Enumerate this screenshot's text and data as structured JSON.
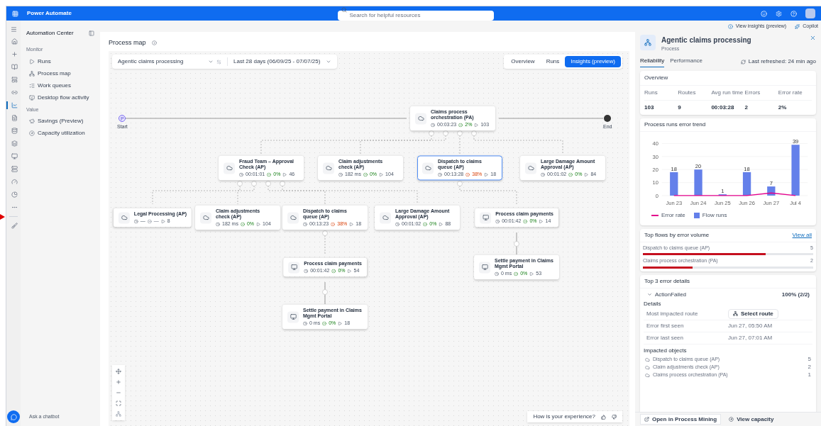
{
  "app_bar": {
    "title": "Power Automate",
    "search": {
      "placeholder": "Search for helpful resources"
    }
  },
  "rail": [
    {
      "selected": false
    },
    {
      "selected": false
    },
    {
      "selected": false
    },
    {
      "selected": false
    },
    {
      "selected": false
    },
    {
      "selected": true
    },
    {
      "selected": false
    },
    {
      "selected": false
    },
    {
      "selected": false
    },
    {
      "selected": false
    },
    {
      "selected": false
    },
    {
      "selected": false
    },
    {
      "selected": false
    },
    {
      "selected": false
    },
    {
      "selected": false
    }
  ],
  "nav": {
    "title": "Automation Center",
    "sections": [
      {
        "heading": "Monitor",
        "items": [
          "Runs",
          "Process map",
          "Work queues",
          "Desktop flow activity"
        ]
      },
      {
        "heading": "Value",
        "items": [
          "Savings (Preview)",
          "Capacity utilization"
        ]
      }
    ],
    "chatbot": "Ask a chatbot"
  },
  "header_links": [
    "View insights (preview)",
    "Copilot"
  ],
  "page_title": "Process map",
  "map": {
    "process_select": "Agentic claims processing",
    "date_range": "Last 28 days (06/09/25 - 07/07/25)",
    "view_tabs": [
      {
        "label": "Overview",
        "selected": false
      },
      {
        "label": "Runs",
        "selected": false
      },
      {
        "label": "Insights (preview)",
        "selected": true
      }
    ],
    "start": {
      "marker": "P",
      "label": "Start"
    },
    "end": {
      "label": "End"
    },
    "nodes": [
      {
        "kind": "cloud",
        "title": "Claims process orchestration (PA)",
        "time": "00:03:23",
        "rate": "2%",
        "warning": false,
        "empty": false,
        "runs": "103",
        "selected": false
      },
      {
        "kind": "cloud",
        "title": "Fraud Team – Approval Check (AP)",
        "time": "00:01:01",
        "rate": "0%",
        "warning": false,
        "empty": false,
        "runs": "46",
        "selected": false
      },
      {
        "kind": "cloud",
        "title": "Claim adjustments check (AP)",
        "time": "182 ms",
        "rate": "0%",
        "warning": false,
        "empty": false,
        "runs": "104",
        "selected": false
      },
      {
        "kind": "cloud",
        "title": "Dispatch to claims queue (AP)",
        "time": "00:13:28",
        "rate": "38%",
        "warning": true,
        "empty": false,
        "runs": "18",
        "selected": true
      },
      {
        "kind": "cloud",
        "title": "Large Damage Amount Approval (AP)",
        "time": "00:01:02",
        "rate": "0%",
        "warning": false,
        "empty": false,
        "runs": "84",
        "selected": false
      },
      {
        "kind": "cloud",
        "title": "Legal Processing (AP)",
        "time": "—",
        "rate": "—",
        "warning": false,
        "empty": true,
        "runs": "8",
        "selected": false
      },
      {
        "kind": "cloud",
        "title": "Claim adjustments check (AP)",
        "time": "182 ms",
        "rate": "0%",
        "warning": false,
        "empty": false,
        "runs": "104",
        "selected": false
      },
      {
        "kind": "cloud",
        "title": "Dispatch to claims queue (AP)",
        "time": "00:13:23",
        "rate": "38%",
        "warning": true,
        "empty": false,
        "runs": "18",
        "selected": false
      },
      {
        "kind": "cloud",
        "title": "Large Damage Amount Approval (AP)",
        "time": "00:01:02",
        "rate": "0%",
        "warning": false,
        "empty": false,
        "runs": "88",
        "selected": false
      },
      {
        "kind": "desktop",
        "title": "Process claim payments",
        "time": "00:01:42",
        "rate": "0%",
        "warning": false,
        "empty": false,
        "runs": "14",
        "selected": false
      },
      {
        "kind": "desktop",
        "title": "Process claim payments",
        "time": "00:01:42",
        "rate": "0%",
        "warning": false,
        "empty": false,
        "runs": "54",
        "selected": false
      },
      {
        "kind": "desktop",
        "title": "Settle payment in Claims Mgmt Portal",
        "time": "0 ms",
        "rate": "0%",
        "warning": false,
        "empty": false,
        "runs": "53",
        "selected": false
      },
      {
        "kind": "desktop",
        "title": "Settle payment in Claims Mgmt Portal",
        "time": "0 ms",
        "rate": "0%",
        "warning": false,
        "empty": false,
        "runs": "18",
        "selected": false
      }
    ],
    "feedback": "How is your experience?"
  },
  "details": {
    "title": "Agentic claims processing",
    "subtitle": "Process",
    "tabs": [
      {
        "label": "Reliability",
        "selected": true
      },
      {
        "label": "Performance",
        "selected": false
      }
    ],
    "refreshed": "Last refreshed: 24 min ago",
    "overview": {
      "title": "Overview",
      "columns": [
        "Runs",
        "Routes",
        "Avg run time",
        "Errors",
        "Error rate"
      ],
      "values": [
        "103",
        "9",
        "00:03:28",
        "2",
        "2%"
      ]
    },
    "trend": {
      "title": "Process runs error trend",
      "chart_data": {
        "type": "bar",
        "categories": [
          "Jun 23",
          "Jun 24",
          "Jun 25",
          "Jun 26",
          "Jun 27",
          "Jul 4"
        ],
        "grid": true,
        "series": [
          {
            "name": "Error rate",
            "type": "line",
            "color": "#e3008c",
            "values": [
              0,
              0,
              0,
              0,
              2,
              0
            ]
          },
          {
            "name": "Flow runs",
            "type": "bar",
            "color": "#6480ea",
            "values": [
              18,
              20,
              1,
              18,
              7,
              39
            ]
          }
        ],
        "legend": "bottom",
        "ylim": [
          0,
          40
        ],
        "yticks": [
          0,
          10,
          20,
          30,
          40
        ],
        "value_labels": [
          null,
          [
            "18",
            "20",
            "1",
            "18",
            "7",
            "39"
          ]
        ]
      }
    },
    "top_flows": {
      "title": "Top flows by error volume",
      "link": "View all",
      "rows": [
        {
          "name": "Dispatch to claims queue (AP)",
          "count": "5",
          "level": 0.72
        },
        {
          "name": "Claims process orchestration (PA)",
          "count": "2",
          "level": 0.29
        }
      ]
    },
    "errors": {
      "title": "Top 3 error details",
      "item": {
        "name": "ActionFailed",
        "share": "100% (2/2)",
        "expanded": true
      },
      "details_heading": "Details",
      "rows": [
        {
          "label": "Most impacted route",
          "button": "Select route"
        },
        {
          "label": "Error first seen",
          "value": "Jun 27, 05:50 AM"
        },
        {
          "label": "Error last seen",
          "value": "Jun 27, 07:01 AM"
        }
      ],
      "impacted_heading": "Impacted objects",
      "impacted": [
        {
          "name": "Dispatch to claims queue (AP)",
          "count": "5"
        },
        {
          "name": "Claim adjustments check (AP)",
          "count": "2"
        },
        {
          "name": "Claims process orchestration (PA)",
          "count": "1"
        }
      ]
    },
    "footer_buttons": [
      "Open in Process Mining",
      "View capacity"
    ]
  }
}
